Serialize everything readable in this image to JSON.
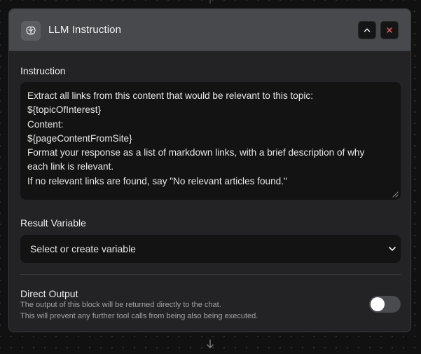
{
  "card": {
    "title": "LLM Instruction",
    "icon": "brain-icon",
    "buttons": {
      "collapse_icon": "chevron-up-icon",
      "close_icon": "close-icon"
    }
  },
  "instruction": {
    "label": "Instruction",
    "value": "Extract all links from this content that would be relevant to this topic:\n${topicOfInterest}\nContent:\n${pageContentFromSite}\nFormat your response as a list of markdown links, with a brief description of why\neach link is relevant.\nIf no relevant links are found, say \"No relevant articles found.\""
  },
  "result_variable": {
    "label": "Result Variable",
    "selected": "Select or create variable"
  },
  "direct_output": {
    "label": "Direct Output",
    "description_line1": "The output of this block will be returned directly to the chat.",
    "description_line2": "This will prevent any further tool calls from being also being executed.",
    "enabled": false
  },
  "colors": {
    "page_bg": "#111112",
    "card_bg": "#232325",
    "header_bg": "#47494c",
    "close_accent": "#e0665c",
    "input_bg": "#131314"
  }
}
